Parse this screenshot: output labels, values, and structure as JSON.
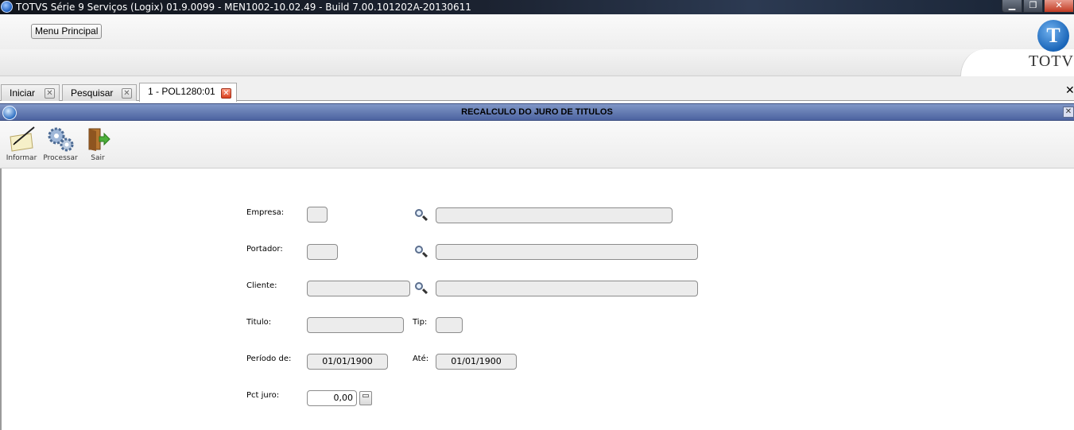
{
  "window": {
    "title": "TOTVS Série 9 Serviços (Logix) 01.9.0099  -  MEN1002-10.02.49 - Build 7.00.101202A-20130611",
    "min_glyph": "▁",
    "max_glyph": "❐",
    "close_glyph": "✕"
  },
  "menu": {
    "main_label": "Menu Principal"
  },
  "brand": {
    "logo_letter": "T",
    "logo_text": "TOTVS"
  },
  "tabs": [
    {
      "label": "Iniciar",
      "active": false
    },
    {
      "label": "Pesquisar",
      "active": false
    },
    {
      "label": "1 - POL1280:01",
      "active": true
    }
  ],
  "tab_close_glyph": "✕",
  "strip_close_glyph": "✕",
  "program": {
    "title": "RECALCULO DO JURO DE TITULOS",
    "close_glyph": "✕"
  },
  "toolbar": {
    "informar": "Informar",
    "processar": "Processar",
    "sair": "Sair"
  },
  "form": {
    "empresa_label": "Empresa:",
    "empresa_code": "",
    "empresa_desc": "",
    "portador_label": "Portador:",
    "portador_code": "",
    "portador_desc": "",
    "cliente_label": "Cliente:",
    "cliente_code": "",
    "cliente_desc": "",
    "titulo_label": "Titulo:",
    "titulo_value": "",
    "tip_label": "Tip:",
    "tip_value": "",
    "periodo_label": "Período de:",
    "periodo_de": "01/01/1900",
    "ate_label": "Até:",
    "periodo_ate": "01/01/1900",
    "pct_label": "Pct juro:",
    "pct_value": "0,00"
  }
}
